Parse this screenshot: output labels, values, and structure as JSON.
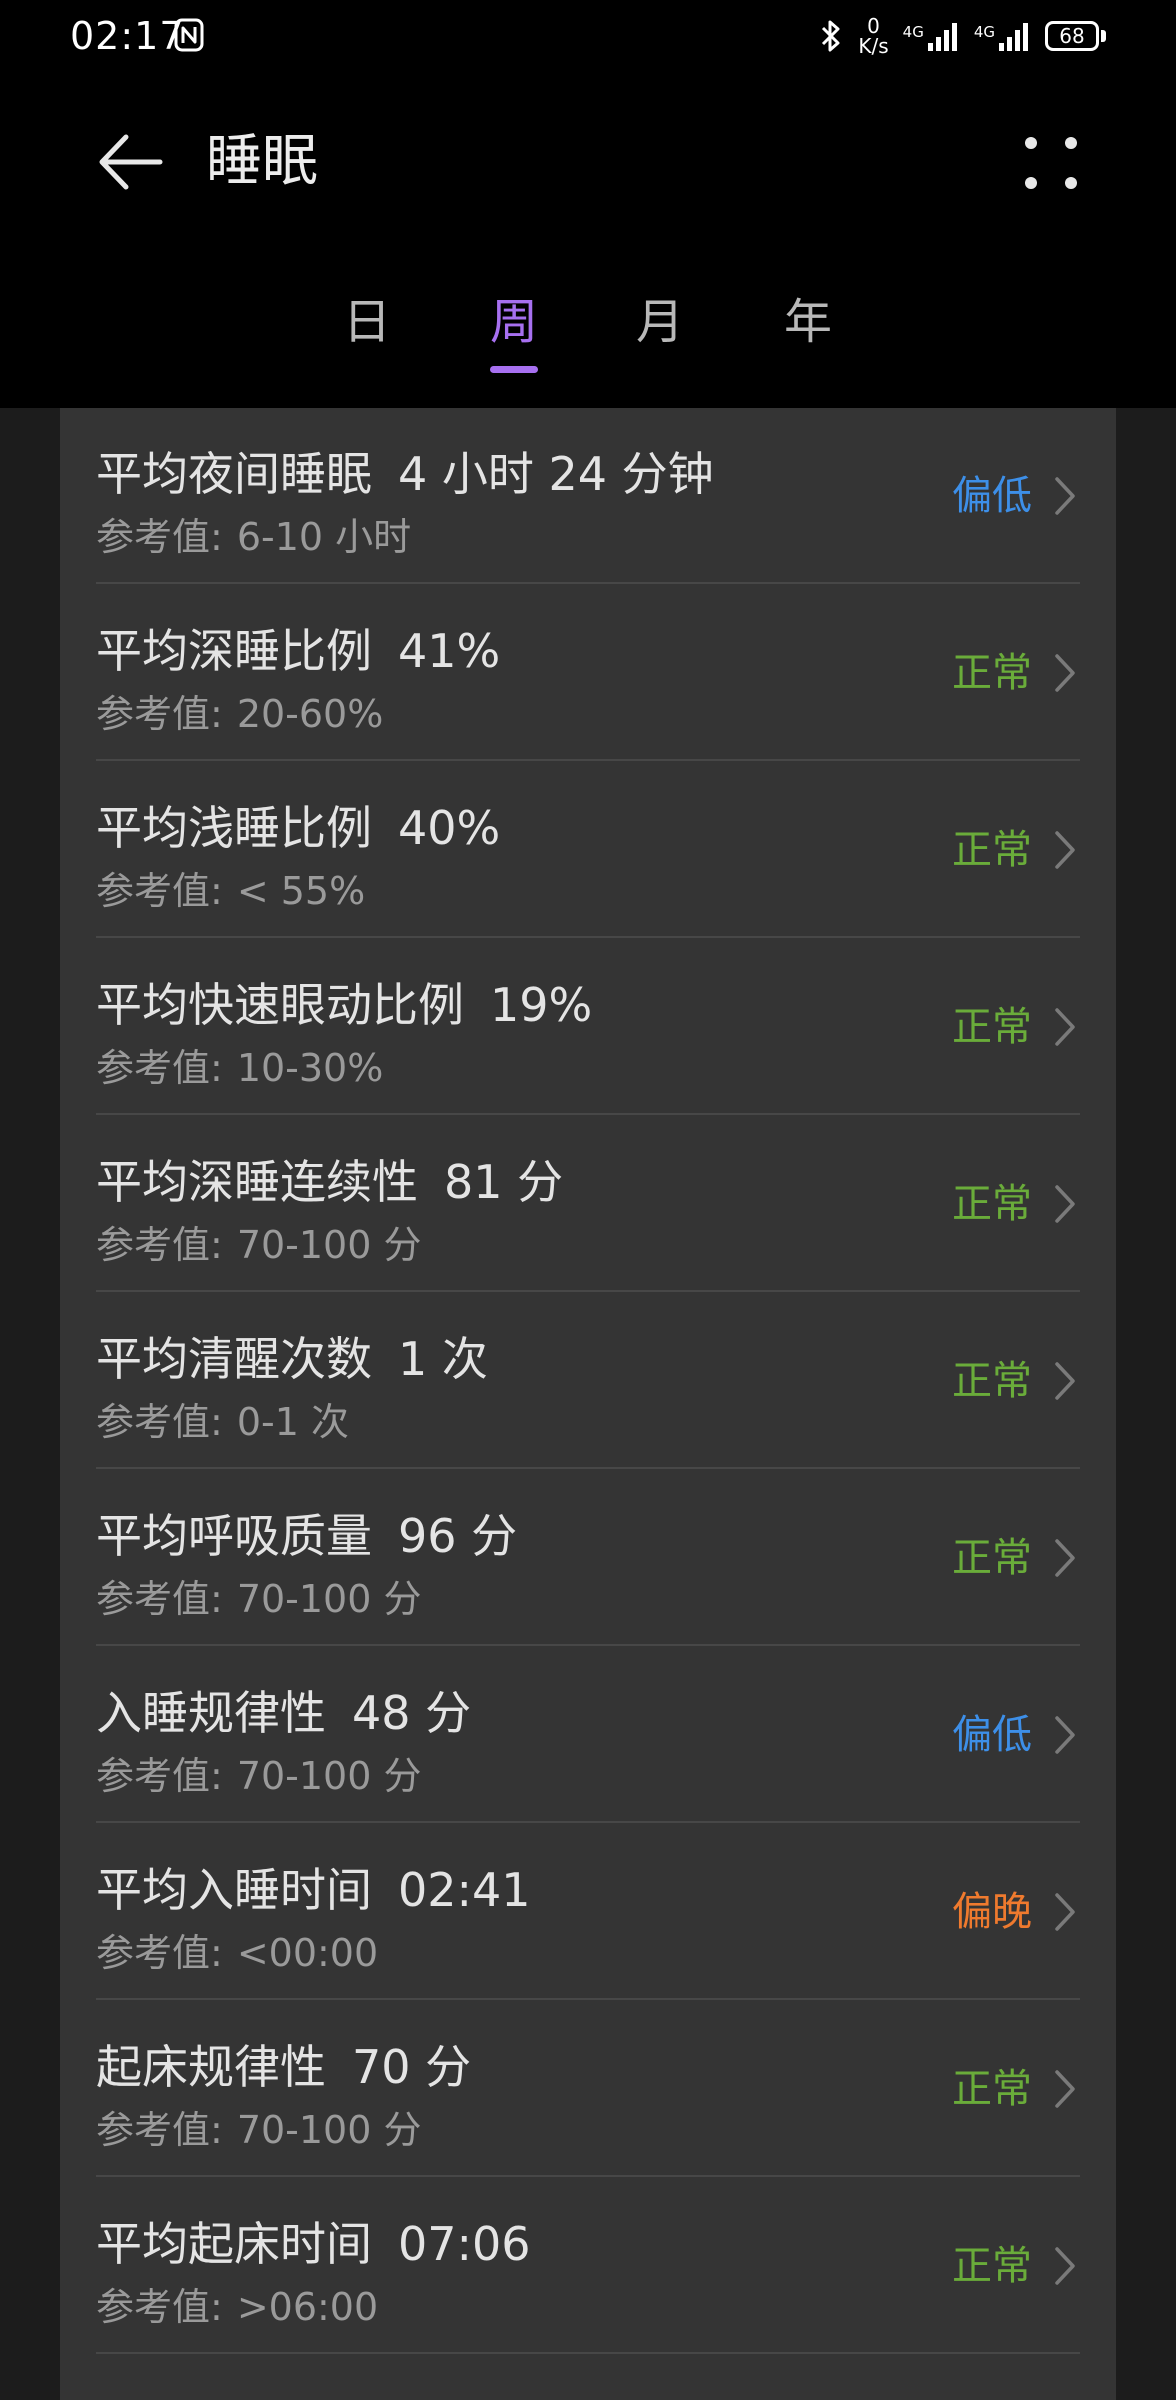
{
  "status_bar": {
    "time": "02:17",
    "net_speed_value": "0",
    "net_speed_unit": "K/s",
    "signal_1_label": "4G",
    "signal_2_label": "4G",
    "battery": "68"
  },
  "header": {
    "title": "睡眠"
  },
  "tabs": [
    {
      "label": "日"
    },
    {
      "label": "周"
    },
    {
      "label": "月"
    },
    {
      "label": "年"
    }
  ],
  "active_tab": "周",
  "colors": {
    "accent": "#a770f0",
    "status_low": "#3d8fe8",
    "status_normal": "#6aac3a",
    "status_late": "#ef7a2e"
  },
  "metrics": [
    {
      "name": "平均夜间睡眠",
      "value": "4 小时 24 分钟",
      "ref_label": "参考值:",
      "ref_value": "6-10 小时",
      "status": "偏低",
      "status_color": "#3d8fe8"
    },
    {
      "name": "平均深睡比例",
      "value": "41%",
      "ref_label": "参考值:",
      "ref_value": "20-60%",
      "status": "正常",
      "status_color": "#6aac3a"
    },
    {
      "name": "平均浅睡比例",
      "value": "40%",
      "ref_label": "参考值:",
      "ref_value": "< 55%",
      "status": "正常",
      "status_color": "#6aac3a"
    },
    {
      "name": "平均快速眼动比例",
      "value": "19%",
      "ref_label": "参考值:",
      "ref_value": "10-30%",
      "status": "正常",
      "status_color": "#6aac3a"
    },
    {
      "name": "平均深睡连续性",
      "value": "81 分",
      "ref_label": "参考值:",
      "ref_value": "70-100 分",
      "status": "正常",
      "status_color": "#6aac3a"
    },
    {
      "name": "平均清醒次数",
      "value": "1 次",
      "ref_label": "参考值:",
      "ref_value": "0-1 次",
      "status": "正常",
      "status_color": "#6aac3a"
    },
    {
      "name": "平均呼吸质量",
      "value": "96 分",
      "ref_label": "参考值:",
      "ref_value": "70-100 分",
      "status": "正常",
      "status_color": "#6aac3a"
    },
    {
      "name": "入睡规律性",
      "value": "48 分",
      "ref_label": "参考值:",
      "ref_value": "70-100 分",
      "status": "偏低",
      "status_color": "#3d8fe8"
    },
    {
      "name": "平均入睡时间",
      "value": "02:41",
      "ref_label": "参考值:",
      "ref_value": "<00:00",
      "status": "偏晚",
      "status_color": "#ef7a2e"
    },
    {
      "name": "起床规律性",
      "value": "70 分",
      "ref_label": "参考值:",
      "ref_value": "70-100 分",
      "status": "正常",
      "status_color": "#6aac3a"
    },
    {
      "name": "平均起床时间",
      "value": "07:06",
      "ref_label": "参考值:",
      "ref_value": ">06:00",
      "status": "正常",
      "status_color": "#6aac3a"
    }
  ]
}
